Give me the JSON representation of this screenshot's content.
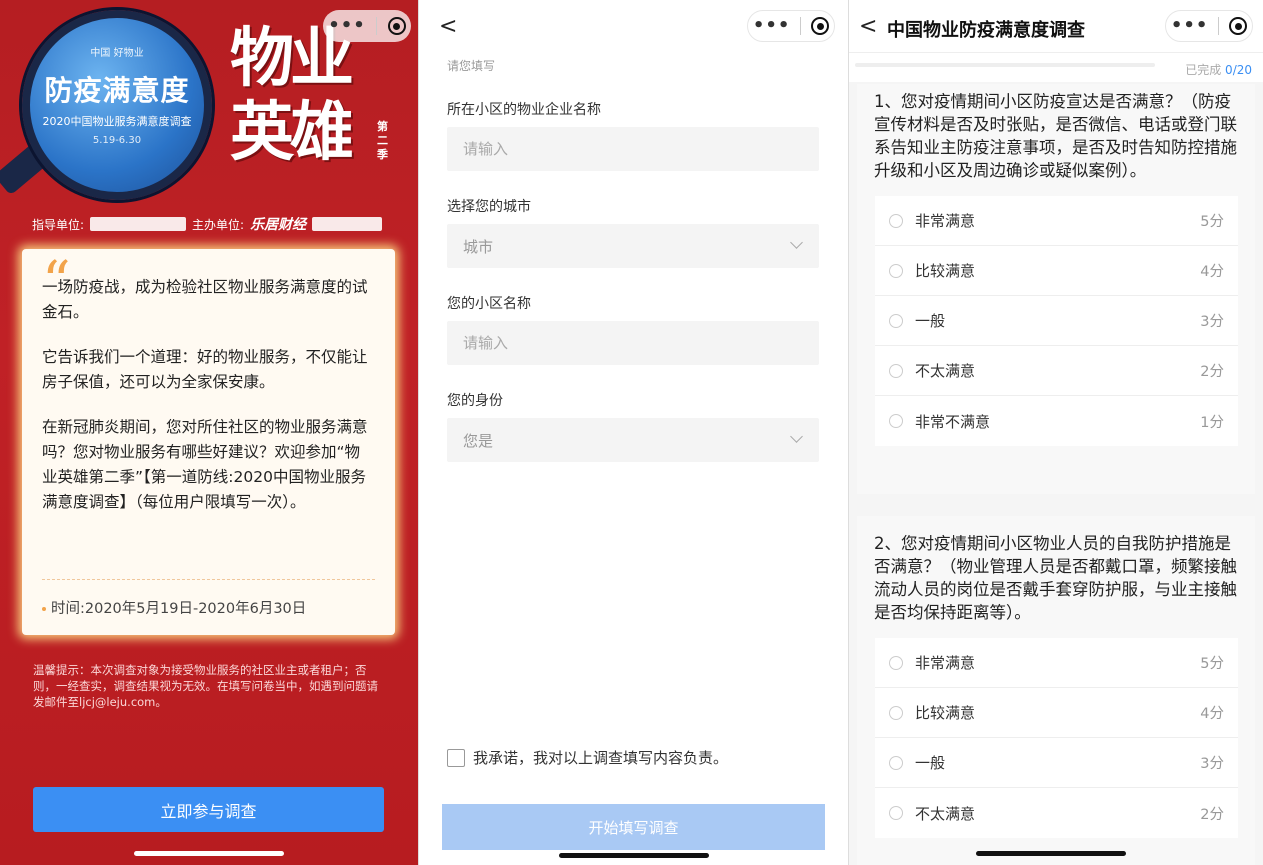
{
  "intro": {
    "logo_small": "中国 好物业",
    "logo_brand": "好物业",
    "lens_title": "防疫满意度",
    "lens_sub": "2020中国物业服务满意度调查",
    "lens_date": "5.19-6.30",
    "hero_line1": "物业",
    "hero_line2": "英雄",
    "season": "第二季",
    "guide_label": "指导单位:",
    "host_label": "主办单位:",
    "host_brand": "乐居财经",
    "quote_mark": "“",
    "paragraphs": [
      "一场防疫战，成为检验社区物业服务满意度的试金石。",
      "它告诉我们一个道理：好的物业服务，不仅能让房子保值，还可以为全家保安康。",
      "在新冠肺炎期间，您对所住社区的物业服务满意吗？您对物业服务有哪些好建议？欢迎参加“物业英雄第二季”【第一道防线:2020中国物业服务满意度调查】（每位用户限填写一次）。"
    ],
    "time": "时间:2020年5月19日-2020年6月30日",
    "tip": "温馨提示：本次调查对象为接受物业服务的社区业主或者租户；否则，一经查实，调查结果视为无效。在填写问卷当中，如遇到问题请发邮件至ljcj@leju.com。",
    "join_button": "立即参与调查"
  },
  "form": {
    "back": "<",
    "hint": "请您填写",
    "fields": [
      {
        "label": "所在小区的物业企业名称",
        "placeholder": "请输入",
        "type": "text"
      },
      {
        "label": "选择您的城市",
        "placeholder": "城市",
        "type": "select"
      },
      {
        "label": "您的小区名称",
        "placeholder": "请输入",
        "type": "text"
      },
      {
        "label": "您的身份",
        "placeholder": "您是",
        "type": "select"
      }
    ],
    "pledge": "我承诺，我对以上调查填写内容负责。",
    "start_button": "开始填写调查"
  },
  "survey": {
    "back": "<",
    "title": "中国物业防疫满意度调查",
    "progress_label": "已完成 ",
    "progress_done": "0",
    "progress_total": "/20",
    "progress_value": 0,
    "questions": [
      {
        "text": "1、您对疫情期间小区防疫宣达是否满意？（防疫宣传材料是否及时张贴，是否微信、电话或登门联系告知业主防疫注意事项，是否及时告知防控措施升级和小区及周边确诊或疑似案例）。",
        "options": [
          {
            "label": "非常满意",
            "score": "5分"
          },
          {
            "label": "比较满意",
            "score": "4分"
          },
          {
            "label": "一般",
            "score": "3分"
          },
          {
            "label": "不太满意",
            "score": "2分"
          },
          {
            "label": "非常不满意",
            "score": "1分"
          }
        ]
      },
      {
        "text": "2、您对疫情期间小区物业人员的自我防护措施是否满意？（物业管理人员是否都戴口罩，频繁接触流动人员的岗位是否戴手套穿防护服，与业主接触是否均保持距离等）。",
        "options": [
          {
            "label": "非常满意",
            "score": "5分"
          },
          {
            "label": "比较满意",
            "score": "4分"
          },
          {
            "label": "一般",
            "score": "3分"
          },
          {
            "label": "不太满意",
            "score": "2分"
          }
        ]
      }
    ]
  },
  "colors": {
    "brand_red": "#c02126",
    "button_blue": "#3b8ff3",
    "disabled_blue": "#a9c9f4",
    "accent_orange": "#f2a34a"
  }
}
